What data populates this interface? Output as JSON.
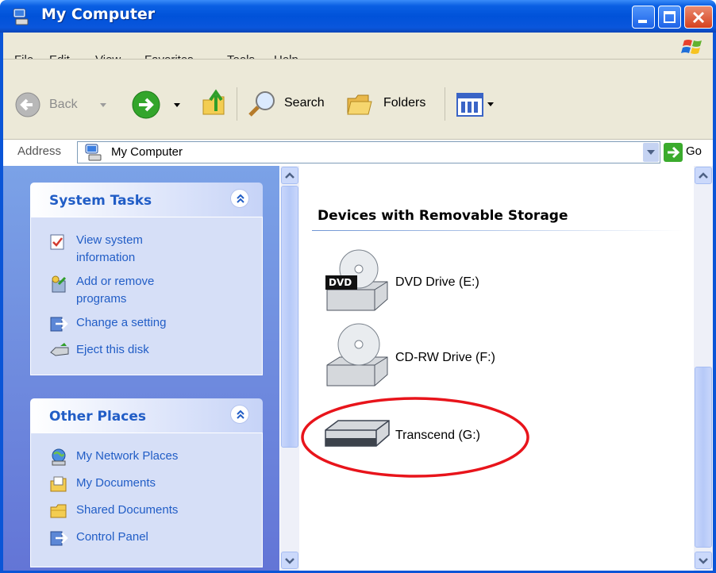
{
  "window": {
    "title": "My Computer",
    "icon": "my-computer-icon"
  },
  "menu": [
    "File",
    "Edit",
    "View",
    "Favorites",
    "Tools",
    "Help"
  ],
  "toolbar": {
    "back_label": "Back",
    "search_label": "Search",
    "folders_label": "Folders"
  },
  "address": {
    "label": "Address",
    "value": "My Computer",
    "go_label": "Go"
  },
  "system_tasks": {
    "title": "System Tasks",
    "items": [
      {
        "label": "View system information",
        "icon": "system-info-icon"
      },
      {
        "label": "Add or remove programs",
        "icon": "add-remove-icon"
      },
      {
        "label": "Change a setting",
        "icon": "control-panel-icon"
      },
      {
        "label": "Eject this disk",
        "icon": "eject-icon"
      }
    ]
  },
  "other_places": {
    "title": "Other Places",
    "items": [
      {
        "label": "My Network Places",
        "icon": "network-places-icon"
      },
      {
        "label": "My Documents",
        "icon": "documents-folder-icon"
      },
      {
        "label": "Shared Documents",
        "icon": "shared-folder-icon"
      },
      {
        "label": "Control Panel",
        "icon": "control-panel-icon"
      }
    ]
  },
  "content": {
    "group_heading": "Devices with Removable Storage",
    "devices": [
      {
        "label": "DVD Drive (E:)",
        "icon": "dvd-drive-icon",
        "badge": "DVD"
      },
      {
        "label": "CD-RW Drive (F:)",
        "icon": "cd-drive-icon"
      },
      {
        "label": "Transcend (G:)",
        "icon": "removable-disk-icon",
        "highlighted": true
      }
    ]
  },
  "colors": {
    "title_bar": "#0a5fe3",
    "task_link": "#215dc6",
    "highlight_circle": "#e8141b"
  }
}
